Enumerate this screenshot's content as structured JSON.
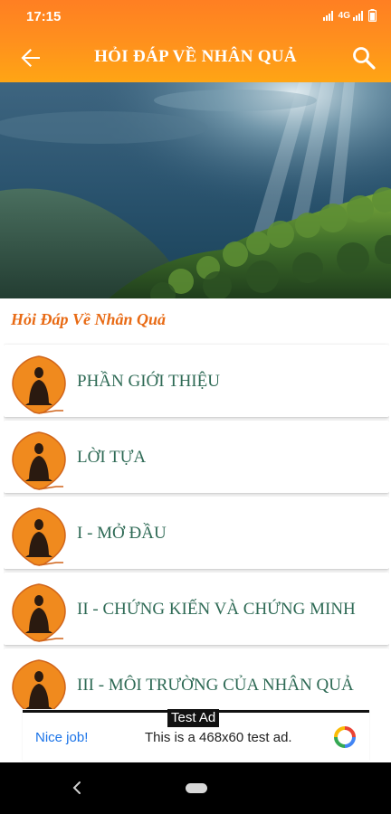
{
  "status_bar": {
    "time": "17:15",
    "network": "4G"
  },
  "toolbar": {
    "title": "HỎI ĐÁP VỀ NHÂN QUẢ",
    "back_icon": "arrow-left-icon",
    "search_icon": "search-icon"
  },
  "section": {
    "header": "Hỏi Đáp Về Nhân Quả"
  },
  "list": {
    "items": [
      {
        "label": "PHẦN GIỚI THIỆU",
        "icon": "buddha-leaf-icon"
      },
      {
        "label": "LỜI TỰA",
        "icon": "buddha-leaf-icon"
      },
      {
        "label": "I - MỞ ĐẦU",
        "icon": "buddha-leaf-icon"
      },
      {
        "label": "II - CHỨNG KIẾN VÀ CHỨNG MINH",
        "icon": "buddha-leaf-icon"
      },
      {
        "label": "III - MÔI TRƯỜNG CỦA NHÂN QUẢ",
        "icon": "buddha-leaf-icon"
      }
    ]
  },
  "ad": {
    "tag": "Test Ad",
    "left_text": "Nice job!",
    "body_text": "This is a 468x60 test ad.",
    "logo_icon": "admob-logo-icon"
  },
  "colors": {
    "appbar": "#ff8a1f",
    "section_header": "#e86a14",
    "item_text": "#2e6a55",
    "ad_link": "#1a73e8"
  }
}
